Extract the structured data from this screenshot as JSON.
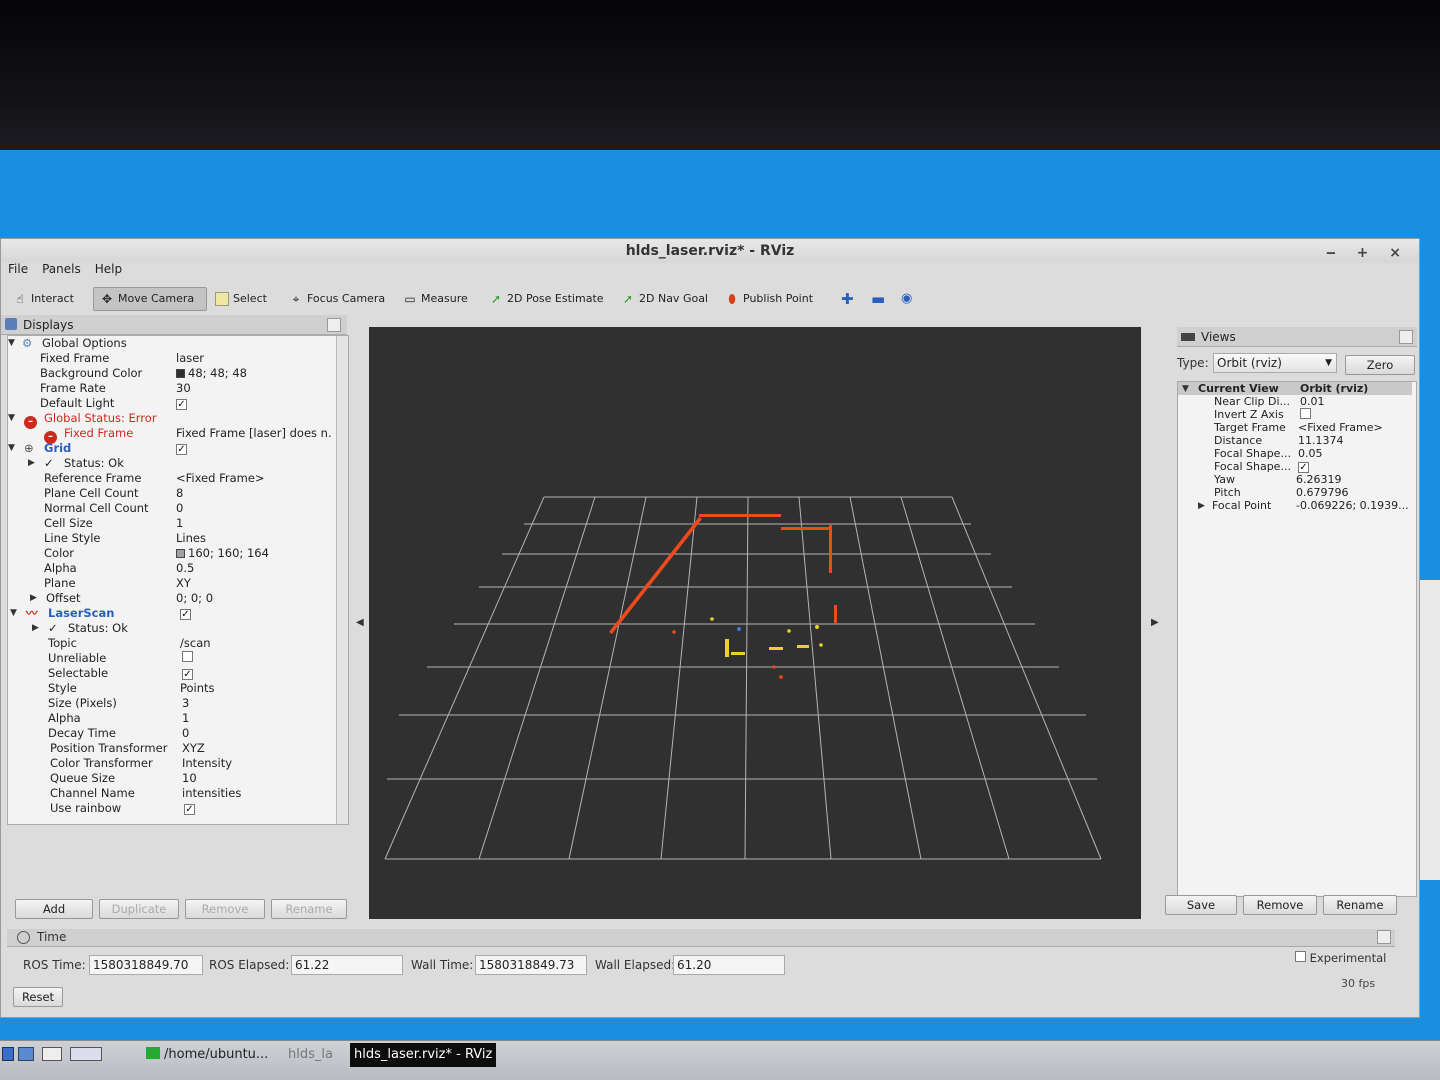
{
  "window": {
    "title": "hlds_laser.rviz* - RViz",
    "controls": "‒ + ×"
  },
  "menu": [
    "File",
    "Panels",
    "Help"
  ],
  "toolbar": {
    "interact": "Interact",
    "move_camera": "Move Camera",
    "select": "Select",
    "focus_camera": "Focus Camera",
    "measure": "Measure",
    "pose_estimate": "2D Pose Estimate",
    "nav_goal": "2D Nav Goal",
    "publish_point": "Publish Point"
  },
  "displays": {
    "title": "Displays",
    "global_options": "Global Options",
    "fixed_frame_k": "Fixed Frame",
    "fixed_frame_v": "laser",
    "bg_color_k": "Background Color",
    "bg_color_v": "48; 48; 48",
    "frame_rate_k": "Frame Rate",
    "frame_rate_v": "30",
    "default_light_k": "Default Light",
    "global_status_k": "Global Status: Error",
    "ff_error_k": "Fixed Frame",
    "ff_error_v": "Fixed Frame [laser] does n.",
    "grid_k": "Grid",
    "grid_status_k": "Status: Ok",
    "ref_frame_k": "Reference Frame",
    "ref_frame_v": "<Fixed Frame>",
    "plane_cells_k": "Plane Cell Count",
    "plane_cells_v": "8",
    "normal_cells_k": "Normal Cell Count",
    "normal_cells_v": "0",
    "cell_size_k": "Cell Size",
    "cell_size_v": "1",
    "line_style_k": "Line Style",
    "line_style_v": "Lines",
    "color_k": "Color",
    "color_v": "160; 160; 164",
    "alpha_k": "Alpha",
    "alpha_v": "0.5",
    "plane_k": "Plane",
    "plane_v": "XY",
    "offset_k": "Offset",
    "offset_v": "0; 0; 0",
    "laserscan_k": "LaserScan",
    "ls_status_k": "Status: Ok",
    "topic_k": "Topic",
    "topic_v": "/scan",
    "unreliable_k": "Unreliable",
    "selectable_k": "Selectable",
    "style_k": "Style",
    "style_v": "Points",
    "size_k": "Size (Pixels)",
    "size_v": "3",
    "ls_alpha_k": "Alpha",
    "ls_alpha_v": "1",
    "decay_k": "Decay Time",
    "decay_v": "0",
    "pos_tf_k": "Position Transformer",
    "pos_tf_v": "XYZ",
    "col_tf_k": "Color Transformer",
    "col_tf_v": "Intensity",
    "queue_k": "Queue Size",
    "queue_v": "10",
    "channel_k": "Channel Name",
    "channel_v": "intensities",
    "rainbow_k": "Use rainbow",
    "buttons": {
      "add": "Add",
      "duplicate": "Duplicate",
      "remove": "Remove",
      "rename": "Rename"
    }
  },
  "views": {
    "title": "Views",
    "type_label": "Type:",
    "type_value": "Orbit (rviz)",
    "zero": "Zero",
    "current_view_k": "Current View",
    "current_view_v": "Orbit (rviz)",
    "near_clip_k": "Near Clip Di...",
    "near_clip_v": "0.01",
    "invert_z_k": "Invert Z Axis",
    "target_frame_k": "Target Frame",
    "target_frame_v": "<Fixed Frame>",
    "distance_k": "Distance",
    "distance_v": "11.1374",
    "focal_shape1_k": "Focal Shape...",
    "focal_shape1_v": "0.05",
    "focal_shape2_k": "Focal Shape...",
    "yaw_k": "Yaw",
    "yaw_v": "6.26319",
    "pitch_k": "Pitch",
    "pitch_v": "0.679796",
    "focal_point_k": "Focal Point",
    "focal_point_v": "-0.069226; 0.1939...",
    "buttons": {
      "save": "Save",
      "remove": "Remove",
      "rename": "Rename"
    }
  },
  "time": {
    "title": "Time",
    "ros_time_label": "ROS Time:",
    "ros_time": "1580318849.70",
    "ros_elapsed_label": "ROS Elapsed:",
    "ros_elapsed": "61.22",
    "wall_time_label": "Wall Time:",
    "wall_time": "1580318849.73",
    "wall_elapsed_label": "Wall Elapsed:",
    "wall_elapsed": "61.20",
    "experimental": "Experimental",
    "reset": "Reset",
    "fps": "30 fps"
  },
  "taskbar": {
    "terminal": "/home/ubuntu...",
    "rviz_small": "hlds_la",
    "rviz_active": "hlds_laser.rviz* - RViz"
  },
  "colors": {
    "viewport_bg": "#303030",
    "grid": "#a0a0a4",
    "error": "#d0281e",
    "desktop": "#1a8ee0"
  }
}
